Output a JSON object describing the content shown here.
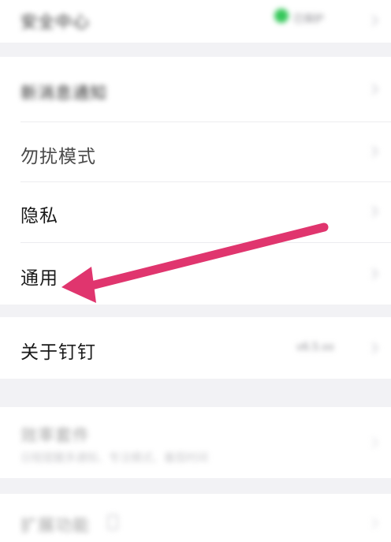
{
  "settings": {
    "security_center": {
      "label": "安全中心",
      "status": "已保护"
    },
    "new_message_notification": {
      "label": "新消息通知"
    },
    "do_not_disturb": {
      "label": "勿扰模式"
    },
    "privacy": {
      "label": "隐私"
    },
    "general": {
      "label": "通用"
    },
    "about": {
      "label": "关于钉钉",
      "version": "v6.5.xx"
    },
    "efficiency_suite": {
      "label": "效率套件",
      "subtitle": "日程提醒多通知、专注模式、番茄时间"
    },
    "extensions": {
      "label": "扩展功能"
    }
  },
  "annotation": {
    "arrow_color": "#e0356e",
    "target": "general"
  },
  "colors": {
    "background": "#f2f2f5",
    "card": "#ffffff",
    "green": "#34c759"
  }
}
